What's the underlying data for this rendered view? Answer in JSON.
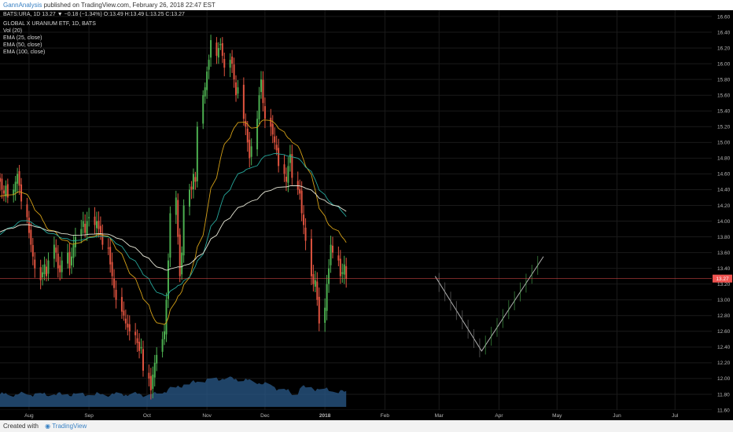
{
  "header": {
    "author": "GannAnalysis",
    "published_text": "published on TradingView.com, February 26, 2018 22:47 EST"
  },
  "footer": {
    "created_with": "Created with",
    "brand": "TradingView"
  },
  "legend": {
    "symbol_line": "BATS:URA, 1D 13.27 ▼ −0.18 (−1.34%) O:13.49 H:13.49 L:13.25 C:13.27",
    "lines": [
      "GLOBAL X URANIUM ETF, 1D, BATS",
      "Vol (20)",
      "EMA (25, close)",
      "EMA (50, close)",
      "EMA (100, close)"
    ]
  },
  "price_label": "13.27",
  "colors": {
    "background": "#000000",
    "grid": "#1a1a1a",
    "up": "#4caf50",
    "down": "#e0533f",
    "volume": "#2a5a8a",
    "ema25": "#d4a017",
    "ema50": "#26a69a",
    "ema100": "#e8e8d8",
    "price_line": "#ef5350",
    "projection": "#d0d0d0"
  },
  "chart_data": {
    "type": "candlestick",
    "symbol": "BATS:URA",
    "interval": "1D",
    "last": {
      "open": 13.49,
      "high": 13.49,
      "low": 13.25,
      "close": 13.27,
      "change": -0.18,
      "change_pct": -1.34
    },
    "ylim": [
      11.6,
      16.6
    ],
    "y_ticks": [
      "11.60",
      "11.80",
      "12.00",
      "12.20",
      "12.40",
      "12.60",
      "12.80",
      "13.00",
      "13.20",
      "13.40",
      "13.60",
      "13.80",
      "14.00",
      "14.20",
      "14.40",
      "14.60",
      "14.80",
      "15.00",
      "15.20",
      "15.40",
      "15.60",
      "15.80",
      "16.00",
      "16.20",
      "16.40",
      "16.60"
    ],
    "x_ticks": [
      "Aug",
      "Sep",
      "Oct",
      "Nov",
      "Dec",
      "2018",
      "Feb",
      "Mar",
      "Apr",
      "May",
      "Jun",
      "Jul"
    ],
    "start_date": "2017-07-17",
    "end_date": "2018-07-20",
    "candles_start": "2017-07-17",
    "closes": [
      14.5,
      14.4,
      14.35,
      14.45,
      14.3,
      14.4,
      14.5,
      14.6,
      14.45,
      14.25,
      14.05,
      13.85,
      13.7,
      13.55,
      13.4,
      13.25,
      13.35,
      13.45,
      13.3,
      13.5,
      13.7,
      13.6,
      13.4,
      13.35,
      13.5,
      13.6,
      13.4,
      13.55,
      13.7,
      13.8,
      13.9,
      14.0,
      13.85,
      14.0,
      14.05,
      13.95,
      14.0,
      13.9,
      13.85,
      13.7,
      13.65,
      13.45,
      13.3,
      13.15,
      13.0,
      12.85,
      12.8,
      12.7,
      12.65,
      12.6,
      12.55,
      12.45,
      12.35,
      12.4,
      12.1,
      12.0,
      11.85,
      12.05,
      12.2,
      12.3,
      12.5,
      12.6,
      13.0,
      13.5,
      14.1,
      14.3,
      13.8,
      13.3,
      13.6,
      14.2,
      14.4,
      14.4,
      14.6,
      14.5,
      15.2,
      15.6,
      15.7,
      15.9,
      16.05,
      16.3,
      16.1,
      16.2,
      16.25,
      16.1,
      15.95,
      16.05,
      16.0,
      15.8,
      15.6,
      15.7,
      15.3,
      15.2,
      15.0,
      14.8,
      14.95,
      15.3,
      15.6,
      15.8,
      15.5,
      15.3,
      15.2,
      15.1,
      15.0,
      14.9,
      14.7,
      14.6,
      14.5,
      14.7,
      14.85,
      14.55,
      14.4,
      14.35,
      14.1,
      13.95,
      13.75,
      13.3,
      13.2,
      13.25,
      13.0,
      12.7,
      12.9,
      13.2,
      13.4,
      13.7,
      13.6,
      13.5,
      13.3,
      13.35,
      13.45,
      13.27
    ],
    "projection": [
      {
        "date": "2018-02-27",
        "value": 13.3
      },
      {
        "date": "2018-03-23",
        "value": 12.35
      },
      {
        "date": "2018-04-24",
        "value": 13.55
      }
    ],
    "current_price": 13.27,
    "series": [
      {
        "name": "Vol (20)"
      },
      {
        "name": "EMA (25, close)"
      },
      {
        "name": "EMA (50, close)"
      },
      {
        "name": "EMA (100, close)"
      }
    ]
  }
}
